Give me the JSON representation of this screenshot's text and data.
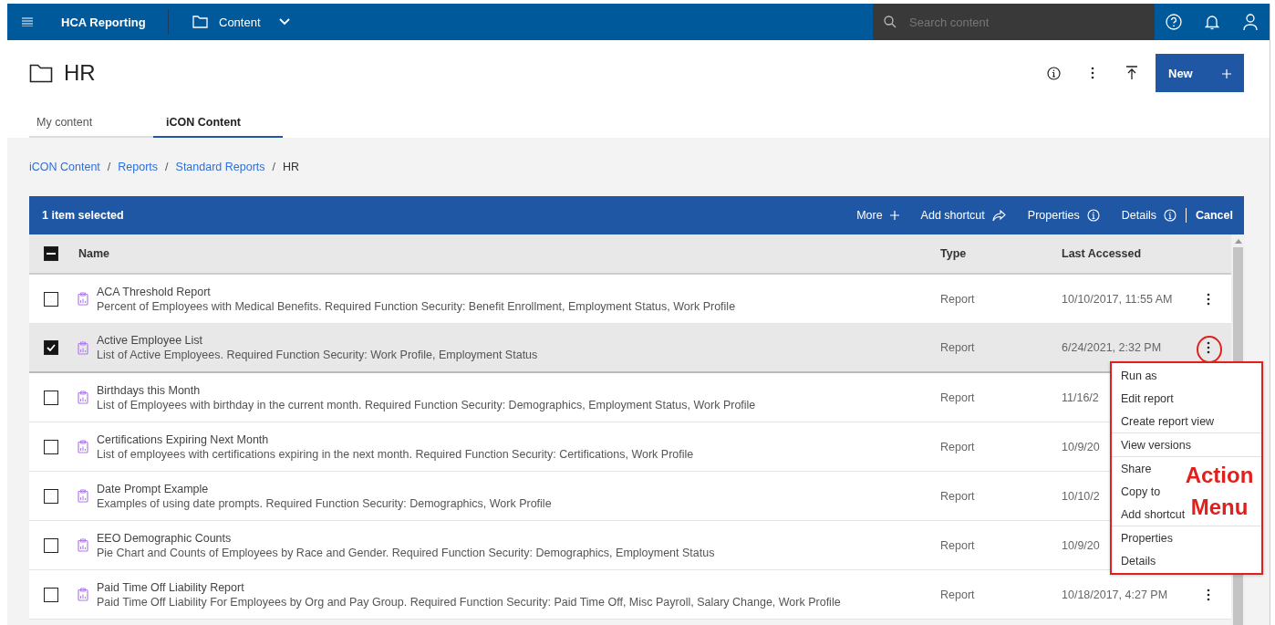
{
  "top_bar": {
    "app_title": "HCA Reporting",
    "section": "Content",
    "search": {
      "placeholder": "Search content"
    }
  },
  "page": {
    "title": "HR",
    "new_button": "New"
  },
  "tabs": [
    {
      "label": "My content",
      "selected": false
    },
    {
      "label": "iCON Content",
      "selected": true
    }
  ],
  "breadcrumb": {
    "separator": "/",
    "items": [
      {
        "label": "iCON Content",
        "current": false
      },
      {
        "label": "Reports",
        "current": false
      },
      {
        "label": "Standard Reports",
        "current": false
      },
      {
        "label": "HR",
        "current": true
      }
    ]
  },
  "selection_bar": {
    "summary": "1 item selected",
    "actions": [
      {
        "label": "More",
        "kind": "plus"
      },
      {
        "label": "Add shortcut",
        "kind": "share"
      },
      {
        "label": "Properties",
        "kind": "info"
      },
      {
        "label": "Details",
        "kind": "info"
      }
    ],
    "cancel": "Cancel"
  },
  "table": {
    "select_all": {
      "indeterminate": true
    },
    "columns": [
      "Name",
      "Type",
      "Last Accessed"
    ],
    "rows": [
      {
        "name": "ACA Threshold Report",
        "description": "Percent of Employees with Medical Benefits. Required Function Security: Benefit Enrollment, Employment Status, Work Profile",
        "type": "Report",
        "last_accessed": "10/10/2017, 11:55 AM",
        "selected": false
      },
      {
        "name": "Active Employee List",
        "description": "List of Active Employees. Required Function Security: Work Profile, Employment Status",
        "type": "Report",
        "last_accessed": "6/24/2021, 2:32 PM",
        "selected": true
      },
      {
        "name": "Birthdays this Month",
        "description": "List of Employees with birthday in the current month. Required Function Security: Demographics, Employment Status, Work Profile",
        "type": "Report",
        "last_accessed": "11/16/2",
        "selected": false
      },
      {
        "name": "Certifications Expiring Next Month",
        "description": "List of employees with certifications expiring in the next month. Required Function Security: Certifications, Work Profile",
        "type": "Report",
        "last_accessed": "10/9/20",
        "selected": false
      },
      {
        "name": "Date Prompt Example",
        "description": "Examples of using date prompts. Required Function Security: Demographics, Work Profile",
        "type": "Report",
        "last_accessed": "10/10/2",
        "selected": false
      },
      {
        "name": "EEO Demographic Counts",
        "description": "Pie Chart and Counts of Employees by Race and Gender. Required Function Security: Demographics, Employment Status",
        "type": "Report",
        "last_accessed": "10/9/20",
        "selected": false
      },
      {
        "name": "Paid Time Off Liability Report",
        "description": "Paid Time Off Liability For Employees by Org and Pay Group. Required Function Security: Paid Time Off, Misc Payroll, Salary Change, Work Profile",
        "type": "Report",
        "last_accessed": "10/18/2017, 4:27 PM",
        "selected": false
      }
    ]
  },
  "action_menu": {
    "groups": [
      {
        "items": [
          "Run as",
          "Edit report",
          "Create report view"
        ]
      },
      {
        "items": [
          "View versions"
        ]
      },
      {
        "items": [
          "Share",
          "Copy to",
          "Add shortcut"
        ]
      },
      {
        "items": [
          "Properties",
          "Details"
        ]
      }
    ]
  },
  "annotation": {
    "text": "Action Menu",
    "circle": true
  }
}
